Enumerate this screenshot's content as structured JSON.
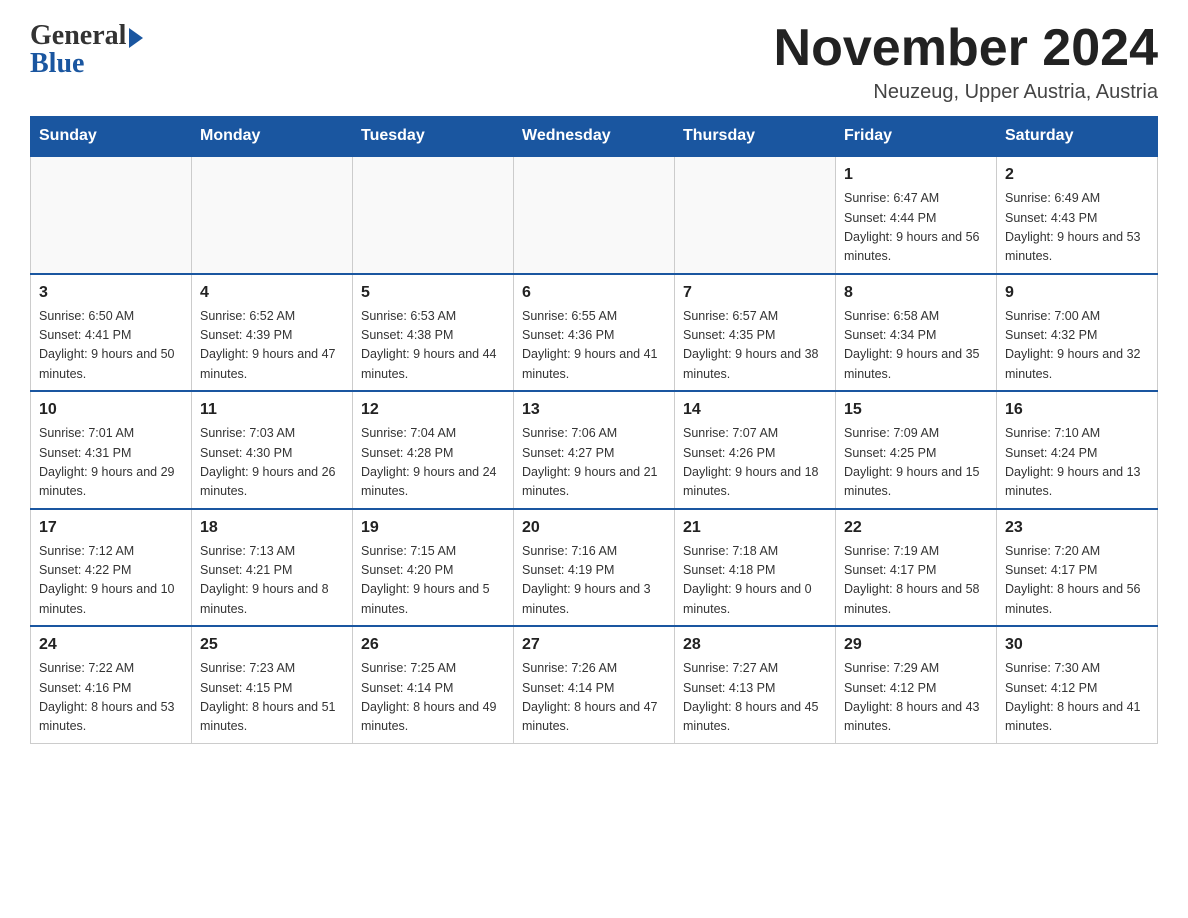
{
  "logo": {
    "line1": "General",
    "line2": "Blue"
  },
  "header": {
    "title": "November 2024",
    "location": "Neuzeug, Upper Austria, Austria"
  },
  "days_of_week": [
    "Sunday",
    "Monday",
    "Tuesday",
    "Wednesday",
    "Thursday",
    "Friday",
    "Saturday"
  ],
  "weeks": [
    {
      "days": [
        {
          "number": "",
          "info": ""
        },
        {
          "number": "",
          "info": ""
        },
        {
          "number": "",
          "info": ""
        },
        {
          "number": "",
          "info": ""
        },
        {
          "number": "",
          "info": ""
        },
        {
          "number": "1",
          "info": "Sunrise: 6:47 AM\nSunset: 4:44 PM\nDaylight: 9 hours and 56 minutes."
        },
        {
          "number": "2",
          "info": "Sunrise: 6:49 AM\nSunset: 4:43 PM\nDaylight: 9 hours and 53 minutes."
        }
      ]
    },
    {
      "days": [
        {
          "number": "3",
          "info": "Sunrise: 6:50 AM\nSunset: 4:41 PM\nDaylight: 9 hours and 50 minutes."
        },
        {
          "number": "4",
          "info": "Sunrise: 6:52 AM\nSunset: 4:39 PM\nDaylight: 9 hours and 47 minutes."
        },
        {
          "number": "5",
          "info": "Sunrise: 6:53 AM\nSunset: 4:38 PM\nDaylight: 9 hours and 44 minutes."
        },
        {
          "number": "6",
          "info": "Sunrise: 6:55 AM\nSunset: 4:36 PM\nDaylight: 9 hours and 41 minutes."
        },
        {
          "number": "7",
          "info": "Sunrise: 6:57 AM\nSunset: 4:35 PM\nDaylight: 9 hours and 38 minutes."
        },
        {
          "number": "8",
          "info": "Sunrise: 6:58 AM\nSunset: 4:34 PM\nDaylight: 9 hours and 35 minutes."
        },
        {
          "number": "9",
          "info": "Sunrise: 7:00 AM\nSunset: 4:32 PM\nDaylight: 9 hours and 32 minutes."
        }
      ]
    },
    {
      "days": [
        {
          "number": "10",
          "info": "Sunrise: 7:01 AM\nSunset: 4:31 PM\nDaylight: 9 hours and 29 minutes."
        },
        {
          "number": "11",
          "info": "Sunrise: 7:03 AM\nSunset: 4:30 PM\nDaylight: 9 hours and 26 minutes."
        },
        {
          "number": "12",
          "info": "Sunrise: 7:04 AM\nSunset: 4:28 PM\nDaylight: 9 hours and 24 minutes."
        },
        {
          "number": "13",
          "info": "Sunrise: 7:06 AM\nSunset: 4:27 PM\nDaylight: 9 hours and 21 minutes."
        },
        {
          "number": "14",
          "info": "Sunrise: 7:07 AM\nSunset: 4:26 PM\nDaylight: 9 hours and 18 minutes."
        },
        {
          "number": "15",
          "info": "Sunrise: 7:09 AM\nSunset: 4:25 PM\nDaylight: 9 hours and 15 minutes."
        },
        {
          "number": "16",
          "info": "Sunrise: 7:10 AM\nSunset: 4:24 PM\nDaylight: 9 hours and 13 minutes."
        }
      ]
    },
    {
      "days": [
        {
          "number": "17",
          "info": "Sunrise: 7:12 AM\nSunset: 4:22 PM\nDaylight: 9 hours and 10 minutes."
        },
        {
          "number": "18",
          "info": "Sunrise: 7:13 AM\nSunset: 4:21 PM\nDaylight: 9 hours and 8 minutes."
        },
        {
          "number": "19",
          "info": "Sunrise: 7:15 AM\nSunset: 4:20 PM\nDaylight: 9 hours and 5 minutes."
        },
        {
          "number": "20",
          "info": "Sunrise: 7:16 AM\nSunset: 4:19 PM\nDaylight: 9 hours and 3 minutes."
        },
        {
          "number": "21",
          "info": "Sunrise: 7:18 AM\nSunset: 4:18 PM\nDaylight: 9 hours and 0 minutes."
        },
        {
          "number": "22",
          "info": "Sunrise: 7:19 AM\nSunset: 4:17 PM\nDaylight: 8 hours and 58 minutes."
        },
        {
          "number": "23",
          "info": "Sunrise: 7:20 AM\nSunset: 4:17 PM\nDaylight: 8 hours and 56 minutes."
        }
      ]
    },
    {
      "days": [
        {
          "number": "24",
          "info": "Sunrise: 7:22 AM\nSunset: 4:16 PM\nDaylight: 8 hours and 53 minutes."
        },
        {
          "number": "25",
          "info": "Sunrise: 7:23 AM\nSunset: 4:15 PM\nDaylight: 8 hours and 51 minutes."
        },
        {
          "number": "26",
          "info": "Sunrise: 7:25 AM\nSunset: 4:14 PM\nDaylight: 8 hours and 49 minutes."
        },
        {
          "number": "27",
          "info": "Sunrise: 7:26 AM\nSunset: 4:14 PM\nDaylight: 8 hours and 47 minutes."
        },
        {
          "number": "28",
          "info": "Sunrise: 7:27 AM\nSunset: 4:13 PM\nDaylight: 8 hours and 45 minutes."
        },
        {
          "number": "29",
          "info": "Sunrise: 7:29 AM\nSunset: 4:12 PM\nDaylight: 8 hours and 43 minutes."
        },
        {
          "number": "30",
          "info": "Sunrise: 7:30 AM\nSunset: 4:12 PM\nDaylight: 8 hours and 41 minutes."
        }
      ]
    }
  ]
}
